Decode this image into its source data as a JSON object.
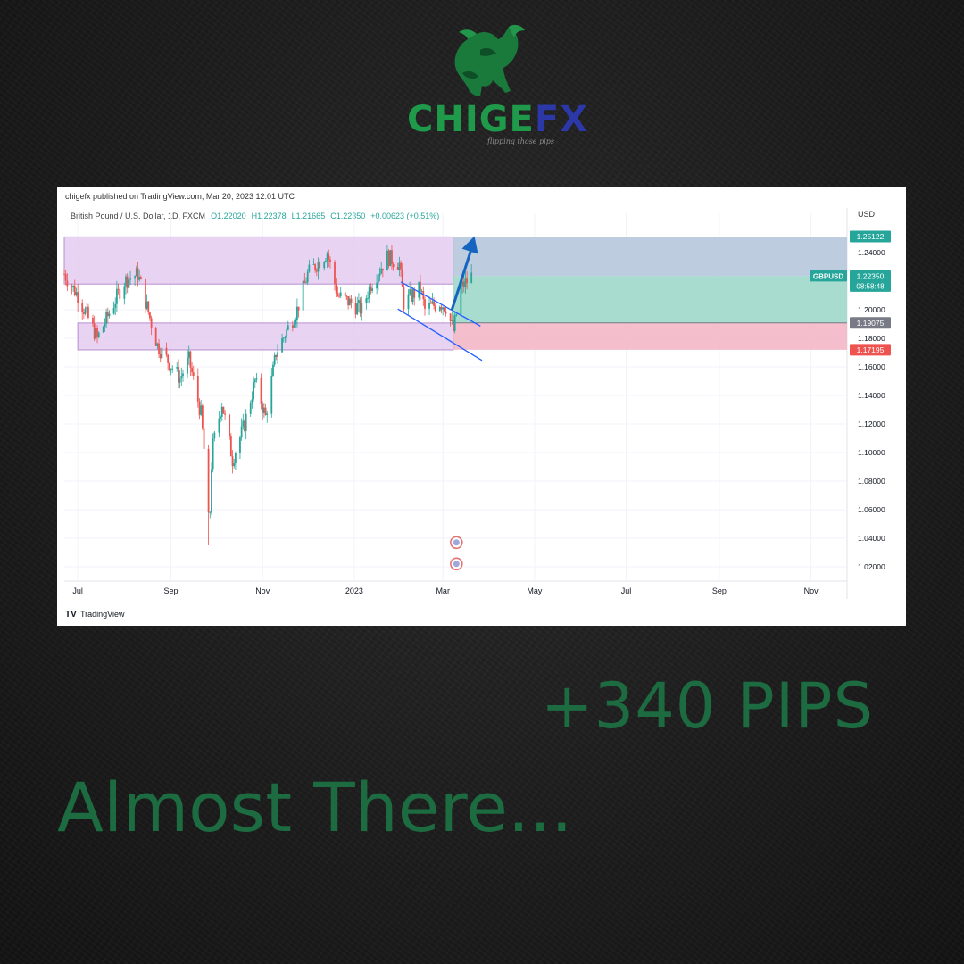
{
  "brand": {
    "part1": "CHIGE",
    "part2": "FX",
    "tagline": "flipping those pips"
  },
  "colors": {
    "brand_green": "#1e9a4a",
    "brand_blue": "#2c37a8",
    "headline_green": "#1d6b40",
    "zone_purple": "#e3c8ef",
    "profit_teal": "#9fd8c9",
    "profit_blue": "#b7c7dc",
    "loss_red": "#f2b3c3",
    "candle_up": "#26a69a",
    "candle_down": "#ef5350",
    "arrow_blue": "#1565c0"
  },
  "headline": {
    "pips": "+340 PIPS",
    "message": "Almost There..."
  },
  "chart_data": {
    "type": "candlestick",
    "publisher_line": "chigefx published on TradingView.com, Mar 20, 2023 12:01 UTC",
    "symbol_line": "British Pound / U.S. Dollar, 1D, FXCM",
    "ohlc_labels": {
      "open": "O1.22020",
      "high": "H1.22378",
      "low": "L1.21665",
      "close": "C1.22350",
      "change": "+0.00623 (+0.51%)"
    },
    "currency": "USD",
    "symbol_tag": "GBPUSD",
    "countdown": "08:58:48",
    "watermark": "TradingView",
    "ylim": [
      1.01,
      1.255
    ],
    "y_ticks": [
      1.24,
      1.2,
      1.18,
      1.16,
      1.14,
      1.12,
      1.1,
      1.08,
      1.06,
      1.04,
      1.02
    ],
    "y_tick_labels": [
      "1.24000",
      "1.20000",
      "1.18000",
      "1.16000",
      "1.14000",
      "1.12000",
      "1.10000",
      "1.08000",
      "1.06000",
      "1.04000",
      "1.02000"
    ],
    "x_ticks": [
      {
        "label": "Jul",
        "date": "2022-07-01"
      },
      {
        "label": "Sep",
        "date": "2022-09-01"
      },
      {
        "label": "Nov",
        "date": "2022-11-01"
      },
      {
        "label": "2023",
        "date": "2023-01-01"
      },
      {
        "label": "Mar",
        "date": "2023-03-01"
      },
      {
        "label": "May",
        "date": "2023-05-01"
      },
      {
        "label": "Jul",
        "date": "2023-07-01"
      },
      {
        "label": "Sep",
        "date": "2023-09-01"
      },
      {
        "label": "Nov",
        "date": "2023-11-01"
      }
    ],
    "xlim": [
      "2022-06-22",
      "2023-11-25"
    ],
    "price_labels": [
      {
        "value": 1.25122,
        "label": "1.25122",
        "kind": "target"
      },
      {
        "value": 1.2235,
        "label": "1.22350",
        "kind": "current"
      },
      {
        "value": 1.19075,
        "label": "1.19075",
        "kind": "entry"
      },
      {
        "value": 1.17195,
        "label": "1.17195",
        "kind": "stop"
      }
    ],
    "zones": [
      {
        "kind": "resistance",
        "from": "2022-06-22",
        "to": "2023-03-08",
        "low": 1.218,
        "high": 1.251
      },
      {
        "kind": "support",
        "from": "2022-07-01",
        "to": "2023-03-08",
        "low": 1.1719,
        "high": 1.1907
      }
    ],
    "position": {
      "start": "2023-03-08",
      "end": "2023-11-25",
      "target": 1.25122,
      "current": 1.2235,
      "entry": 1.19075,
      "stop": 1.17195
    },
    "channel": {
      "upper": [
        {
          "date": "2023-02-01",
          "value": 1.2195
        },
        {
          "date": "2023-03-26",
          "value": 1.1885
        }
      ],
      "lower": [
        {
          "date": "2023-01-30",
          "value": 1.2005
        },
        {
          "date": "2023-03-27",
          "value": 1.1645
        }
      ]
    },
    "arrow": {
      "from": {
        "date": "2023-03-07",
        "value": 1.2
      },
      "to": {
        "date": "2023-03-22",
        "value": 1.2515
      }
    },
    "closes": [
      {
        "date": "2022-06-22",
        "value": 1.225
      },
      {
        "date": "2022-07-01",
        "value": 1.21
      },
      {
        "date": "2022-07-14",
        "value": 1.18
      },
      {
        "date": "2022-08-01",
        "value": 1.22
      },
      {
        "date": "2022-08-10",
        "value": 1.225
      },
      {
        "date": "2022-08-23",
        "value": 1.175
      },
      {
        "date": "2022-09-07",
        "value": 1.152
      },
      {
        "date": "2022-09-13",
        "value": 1.165
      },
      {
        "date": "2022-09-21",
        "value": 1.127
      },
      {
        "date": "2022-09-26",
        "value": 1.065
      },
      {
        "date": "2022-09-29",
        "value": 1.105
      },
      {
        "date": "2022-10-05",
        "value": 1.135
      },
      {
        "date": "2022-10-12",
        "value": 1.095
      },
      {
        "date": "2022-10-20",
        "value": 1.12
      },
      {
        "date": "2022-10-27",
        "value": 1.15
      },
      {
        "date": "2022-11-03",
        "value": 1.125
      },
      {
        "date": "2022-11-10",
        "value": 1.17
      },
      {
        "date": "2022-11-24",
        "value": 1.2
      },
      {
        "date": "2022-12-01",
        "value": 1.225
      },
      {
        "date": "2022-12-14",
        "value": 1.24
      },
      {
        "date": "2022-12-21",
        "value": 1.21
      },
      {
        "date": "2022-12-29",
        "value": 1.205
      },
      {
        "date": "2023-01-06",
        "value": 1.2
      },
      {
        "date": "2023-01-12",
        "value": 1.218
      },
      {
        "date": "2023-01-23",
        "value": 1.237
      },
      {
        "date": "2023-01-31",
        "value": 1.232
      },
      {
        "date": "2023-02-03",
        "value": 1.205
      },
      {
        "date": "2023-02-14",
        "value": 1.215
      },
      {
        "date": "2023-02-17",
        "value": 1.2
      },
      {
        "date": "2023-02-27",
        "value": 1.205
      },
      {
        "date": "2023-03-03",
        "value": 1.202
      },
      {
        "date": "2023-03-08",
        "value": 1.185
      },
      {
        "date": "2023-03-13",
        "value": 1.215
      },
      {
        "date": "2023-03-20",
        "value": 1.2235
      }
    ],
    "events": [
      {
        "date": "2023-03-10",
        "value": 1.037
      },
      {
        "date": "2023-03-10",
        "value": 1.022
      }
    ]
  }
}
